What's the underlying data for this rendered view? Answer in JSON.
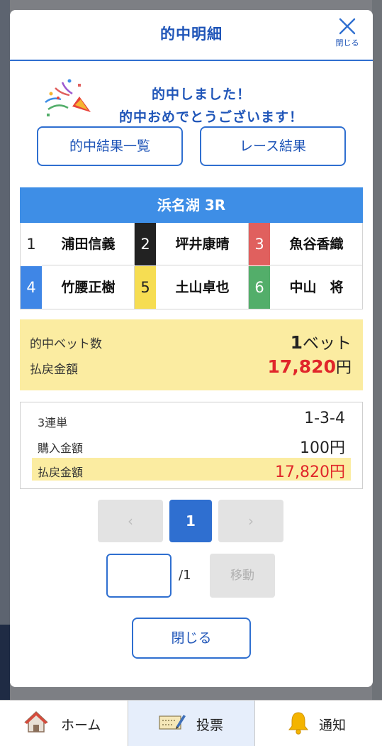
{
  "modal": {
    "title": "的中明細",
    "close_label": "閉じる"
  },
  "message": {
    "line1": "的中しました！",
    "line2": "的中おめでとうございます！"
  },
  "buttons": {
    "results_list": "的中結果一覧",
    "race_results": "レース結果"
  },
  "race": {
    "title": "浜名湖 3R",
    "racers": [
      {
        "num": "1",
        "name": "浦田信義",
        "bg": "#ffffff",
        "fg": "#222222"
      },
      {
        "num": "2",
        "name": "坪井康晴",
        "bg": "#222222",
        "fg": "#ffffff"
      },
      {
        "num": "3",
        "name": "魚谷香織",
        "bg": "#e0605e",
        "fg": "#ffffff"
      },
      {
        "num": "4",
        "name": "竹腰正樹",
        "bg": "#3f86e6",
        "fg": "#ffffff"
      },
      {
        "num": "5",
        "name": "土山卓也",
        "bg": "#f6dd52",
        "fg": "#222222"
      },
      {
        "num": "6",
        "name": "中山　将",
        "bg": "#53ae6a",
        "fg": "#ffffff"
      }
    ]
  },
  "summary": {
    "bets_label": "的中ベット数",
    "bets_count": "1",
    "bets_unit": "ベット",
    "payout_label": "払戻金額",
    "payout_value": "17,820",
    "payout_unit": "円"
  },
  "detail": {
    "bet_type": "3連単",
    "combination": "1-3-4",
    "purchase_label": "購入金額",
    "purchase_value": "100円",
    "payout_label": "払戻金額",
    "payout_value": "17,820円"
  },
  "pager": {
    "prev": "‹",
    "current": "1",
    "next": "›",
    "input_value": "",
    "total": "/1",
    "move": "移動"
  },
  "close_button": "閉じる",
  "tabbar": {
    "home": "ホーム",
    "vote": "投票",
    "notify": "通知"
  },
  "colors": {
    "accent": "#2f6fd0",
    "header_blue": "#3e8ee6",
    "highlight": "#fbeca1",
    "payout_red": "#e0262a"
  }
}
